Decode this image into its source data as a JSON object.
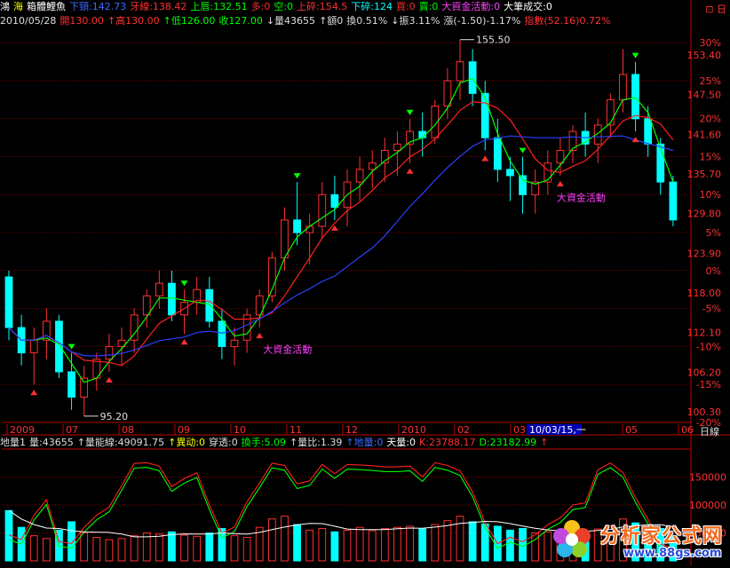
{
  "header": {
    "items": [
      {
        "text": "鴻",
        "color": "#ffffff"
      },
      {
        "text": "海",
        "color": "#ffff00"
      },
      {
        "text": "箱體鯉魚",
        "color": "#ffffff"
      },
      {
        "text": "下頸:142.73",
        "color": "#3a6bff"
      },
      {
        "text": "牙線:138.42",
        "color": "#ff3030"
      },
      {
        "text": "上唇:132.51",
        "color": "#00ff00"
      },
      {
        "text": "多:0",
        "color": "#ff3030"
      },
      {
        "text": "空:0",
        "color": "#00ff00"
      },
      {
        "text": "上碎:154.5",
        "color": "#ff3030"
      },
      {
        "text": "下碎:124",
        "color": "#00ffff"
      },
      {
        "text": "買:0",
        "color": "#ff3030"
      },
      {
        "text": "賣:0",
        "color": "#00ff00"
      },
      {
        "text": "大資金活動:0",
        "color": "#ff40ff"
      },
      {
        "text": "大筆成交:0",
        "color": "#ffffff"
      }
    ],
    "quote": [
      {
        "text": "2010/05/28",
        "color": "#dddddd"
      },
      {
        "text": "開130.00",
        "color": "#ff3030"
      },
      {
        "text": "↑高130.00",
        "color": "#ff3030"
      },
      {
        "text": "↑低126.00",
        "color": "#00ff00"
      },
      {
        "text": "收127.00",
        "color": "#00ff00"
      },
      {
        "text": "↓量43655",
        "color": "#dddddd"
      },
      {
        "text": "↑額0",
        "color": "#dddddd"
      },
      {
        "text": "換0.51%",
        "color": "#dddddd"
      },
      {
        "text": "↓振3.11%",
        "color": "#dddddd"
      },
      {
        "text": "漲(-1.50)-1.17%",
        "color": "#dddddd"
      },
      {
        "text": "指數(52.16)0.72%",
        "color": "#ff3030"
      }
    ],
    "corner": "⊡ 日"
  },
  "subheader": {
    "items": [
      {
        "text": "地量1",
        "color": "#dddddd"
      },
      {
        "text": "量:43655",
        "color": "#dddddd"
      },
      {
        "text": "↑量能線:49091.75",
        "color": "#dddddd"
      },
      {
        "text": "↑異动:0",
        "color": "#ffff00"
      },
      {
        "text": "穿透:0",
        "color": "#dddddd"
      },
      {
        "text": "換手:5.09",
        "color": "#00ff00"
      },
      {
        "text": "↑量比:1.39",
        "color": "#dddddd"
      },
      {
        "text": "↑地量:0",
        "color": "#3a6bff"
      },
      {
        "text": "天量:0",
        "color": "#ffffff"
      },
      {
        "text": "K:23788.17",
        "color": "#ff3030"
      },
      {
        "text": "D:23182.99",
        "color": "#00ff00"
      },
      {
        "text": "↑",
        "color": "#ff3030"
      }
    ]
  },
  "price_axis": {
    "labels": [
      "153.40",
      "147.50",
      "141.60",
      "135.70",
      "129.80",
      "123.90",
      "118.00",
      "112.10",
      "106.20",
      "100.30"
    ],
    "percents": [
      "30%",
      "25%",
      "20%",
      "15%",
      "10%",
      "5%",
      "0%",
      "-5%",
      "-10%",
      "-15%",
      "-20%"
    ]
  },
  "volume_axis": {
    "labels": [
      "150000",
      "100000",
      "50000"
    ]
  },
  "time_axis": {
    "labels": [
      "2009",
      "07",
      "08",
      "09",
      "10",
      "11",
      "12",
      "2010",
      "02",
      "03",
      "04",
      "05",
      "06"
    ],
    "highlight": "10/03/15,一",
    "period": "日線"
  },
  "annotations": {
    "high": "155.50",
    "low": "95.20",
    "signal_1": "大資金活動",
    "signal_2": "大資金活動"
  },
  "watermark": {
    "name": "分析家公式网",
    "url": "www.88gs.com"
  },
  "colors": {
    "bg": "#000000",
    "up": "#ff3030",
    "down": "#00ffff",
    "grid": "#8b0000",
    "ma_green": "#00ff00",
    "ma_red": "#ff2020",
    "ma_blue": "#2a40ff"
  },
  "chart_data": {
    "type": "candlestick",
    "title": "",
    "xlabel": "",
    "ylabel": "",
    "ylim": [
      95,
      157
    ],
    "ohlc": [
      [
        118,
        119,
        108,
        110
      ],
      [
        110,
        112,
        104,
        106
      ],
      [
        106,
        110,
        101,
        108
      ],
      [
        108,
        113,
        105,
        111
      ],
      [
        111,
        112,
        102,
        103
      ],
      [
        103,
        106,
        97,
        99
      ],
      [
        99,
        104,
        96,
        102
      ],
      [
        102,
        106,
        100,
        105
      ],
      [
        105,
        109,
        103,
        107
      ],
      [
        107,
        110,
        104,
        108
      ],
      [
        108,
        113,
        106,
        112
      ],
      [
        112,
        116,
        110,
        115
      ],
      [
        115,
        119,
        113,
        117
      ],
      [
        117,
        119,
        111,
        112
      ],
      [
        112,
        116,
        109,
        114
      ],
      [
        114,
        118,
        112,
        116
      ],
      [
        116,
        118,
        110,
        111
      ],
      [
        111,
        113,
        105,
        107
      ],
      [
        107,
        110,
        104,
        108
      ],
      [
        108,
        113,
        106,
        112
      ],
      [
        112,
        116,
        110,
        115
      ],
      [
        115,
        122,
        114,
        121
      ],
      [
        121,
        129,
        119,
        127
      ],
      [
        127,
        133,
        123,
        125
      ],
      [
        125,
        128,
        120,
        126
      ],
      [
        126,
        133,
        124,
        131
      ],
      [
        131,
        134,
        127,
        129
      ],
      [
        129,
        135,
        126,
        133
      ],
      [
        133,
        137,
        130,
        135
      ],
      [
        135,
        138,
        132,
        136
      ],
      [
        136,
        140,
        133,
        138
      ],
      [
        138,
        141,
        134,
        139
      ],
      [
        139,
        143,
        136,
        141
      ],
      [
        141,
        144,
        137,
        140
      ],
      [
        140,
        146,
        139,
        145
      ],
      [
        145,
        151,
        143,
        149
      ],
      [
        149,
        155.5,
        146,
        152
      ],
      [
        152,
        154,
        145,
        147
      ],
      [
        147,
        149,
        138,
        140
      ],
      [
        140,
        143,
        133,
        135
      ],
      [
        135,
        137,
        130,
        134
      ],
      [
        134,
        137,
        128,
        131
      ],
      [
        131,
        135,
        128,
        133
      ],
      [
        133,
        138,
        131,
        136
      ],
      [
        136,
        140,
        134,
        138
      ],
      [
        138,
        142,
        136,
        141
      ],
      [
        141,
        144,
        137,
        139
      ],
      [
        139,
        143,
        136,
        142
      ],
      [
        142,
        147,
        140,
        146
      ],
      [
        146,
        154,
        144,
        150
      ],
      [
        150,
        152,
        141,
        143
      ],
      [
        143,
        145,
        137,
        139
      ],
      [
        139,
        140,
        131,
        133
      ],
      [
        133,
        134,
        126,
        127
      ]
    ],
    "volume": [
      90000,
      60000,
      45000,
      40000,
      55000,
      70000,
      50000,
      42000,
      38000,
      40000,
      45000,
      50000,
      48000,
      52000,
      46000,
      44000,
      50000,
      58000,
      45000,
      42000,
      60000,
      75000,
      80000,
      65000,
      55000,
      58000,
      52000,
      55000,
      60000,
      54000,
      58000,
      60000,
      62000,
      57000,
      65000,
      72000,
      80000,
      70000,
      66000,
      62000,
      55000,
      58000,
      50000,
      52000,
      54000,
      56000,
      53000,
      57000,
      62000,
      75000,
      68000,
      60000,
      58000,
      43655
    ]
  }
}
